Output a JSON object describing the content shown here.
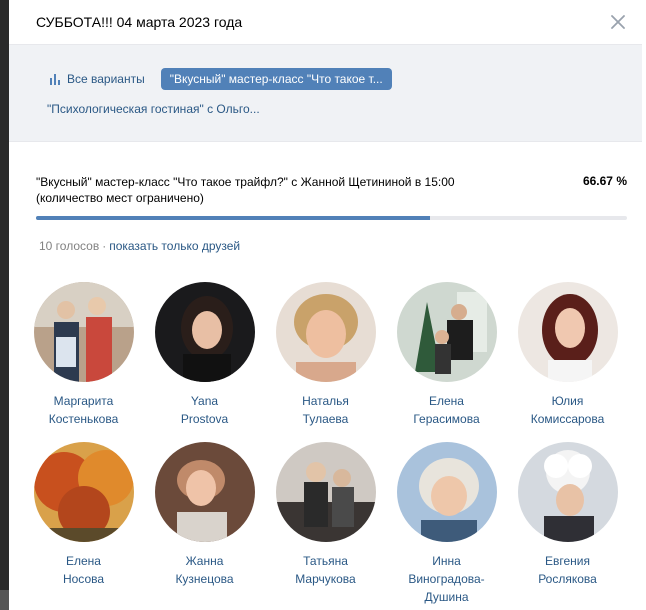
{
  "dialog": {
    "title": "СУББОТА!!! 04 марта 2023 года",
    "accent_color": "#5181b8",
    "link_color": "#2a5885"
  },
  "tabs": {
    "all_label": "Все варианты",
    "selected_label": "\"Вкусный\" мастер-класс \"Что такое т...",
    "second_label": "\"Психологическая гостиная\" с Ольго..."
  },
  "question": {
    "text": "\"Вкусный\" мастер-класс \"Что такое трайфл?\" с Жанной Щетининой в 15:00 (количество мест ограничено)",
    "percent_label": "66.67 %",
    "progress": 0.6667
  },
  "votes": {
    "count": "10 голосов",
    "separator": "·",
    "friends_link": "показать только друзей"
  },
  "users": [
    {
      "first": "Маргарита",
      "last": "Костенькова"
    },
    {
      "first": "Yana",
      "last": "Prostova"
    },
    {
      "first": "Наталья",
      "last": "Тулаева"
    },
    {
      "first": "Елена",
      "last": "Герасимова"
    },
    {
      "first": "Юлия",
      "last": "Комиссарова"
    },
    {
      "first": "Елена",
      "last": "Носова"
    },
    {
      "first": "Жанна",
      "last": "Кузнецова"
    },
    {
      "first": "Татьяна",
      "last": "Марчукова"
    },
    {
      "first": "Инна",
      "last": "Виноградова-",
      "extra": "Душина"
    },
    {
      "first": "Евгения",
      "last": "Рослякова"
    }
  ]
}
